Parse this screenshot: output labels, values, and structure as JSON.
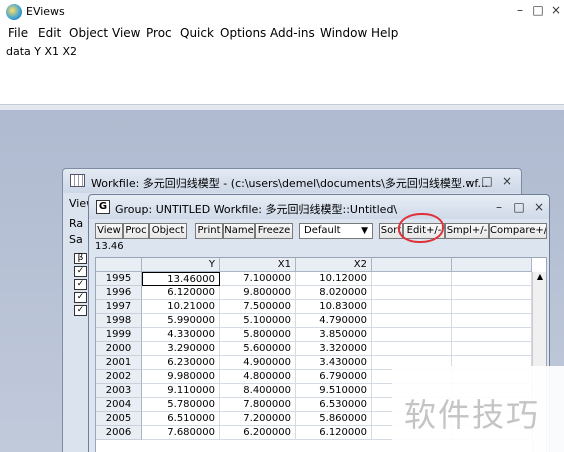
{
  "app": {
    "title": "EViews",
    "window_controls": [
      "–",
      "□",
      "×"
    ]
  },
  "menu": [
    "File",
    "Edit",
    "Object",
    "View",
    "Proc",
    "Quick",
    "Options",
    "Add-ins",
    "Window",
    "Help"
  ],
  "command": {
    "text": "data  Y X1 X2"
  },
  "workfile": {
    "title": "Workfile: 多元回归线模型 - (c:\\users\\demel\\documents\\多元回归线模型.wf...",
    "side_labels": [
      "View",
      "Ra",
      "Sa"
    ],
    "controls": [
      "–",
      "□",
      "×"
    ]
  },
  "group": {
    "badge": "G",
    "title": "Group: UNTITLED   Workfile: 多元回归线模型::Untitled\\",
    "controls": [
      "–",
      "□",
      "×"
    ],
    "toolbar": [
      "View",
      "Proc",
      "Object",
      "Print",
      "Name",
      "Freeze",
      "Sort",
      "Edit+/-",
      "Smpl+/-",
      "Compare+/-"
    ],
    "display_select": "Default",
    "edit_value": "13.46",
    "columns": [
      "Y",
      "X1",
      "X2"
    ],
    "rows": [
      {
        "obs": "1995",
        "y": "13.46000",
        "x1": "7.100000",
        "x2": "10.12000"
      },
      {
        "obs": "1996",
        "y": "6.120000",
        "x1": "9.800000",
        "x2": "8.020000"
      },
      {
        "obs": "1997",
        "y": "10.21000",
        "x1": "7.500000",
        "x2": "10.83000"
      },
      {
        "obs": "1998",
        "y": "5.990000",
        "x1": "5.100000",
        "x2": "4.790000"
      },
      {
        "obs": "1999",
        "y": "4.330000",
        "x1": "5.800000",
        "x2": "3.850000"
      },
      {
        "obs": "2000",
        "y": "3.290000",
        "x1": "5.600000",
        "x2": "3.320000"
      },
      {
        "obs": "2001",
        "y": "6.230000",
        "x1": "4.900000",
        "x2": "3.430000"
      },
      {
        "obs": "2002",
        "y": "9.980000",
        "x1": "4.800000",
        "x2": "6.790000"
      },
      {
        "obs": "2003",
        "y": "9.110000",
        "x1": "8.400000",
        "x2": "9.510000"
      },
      {
        "obs": "2004",
        "y": "5.780000",
        "x1": "7.800000",
        "x2": "6.530000"
      },
      {
        "obs": "2005",
        "y": "6.510000",
        "x1": "7.200000",
        "x2": "5.860000"
      },
      {
        "obs": "2006",
        "y": "7.680000",
        "x1": "6.200000",
        "x2": "6.120000"
      }
    ]
  },
  "watermark": {
    "text": "软件技巧"
  }
}
